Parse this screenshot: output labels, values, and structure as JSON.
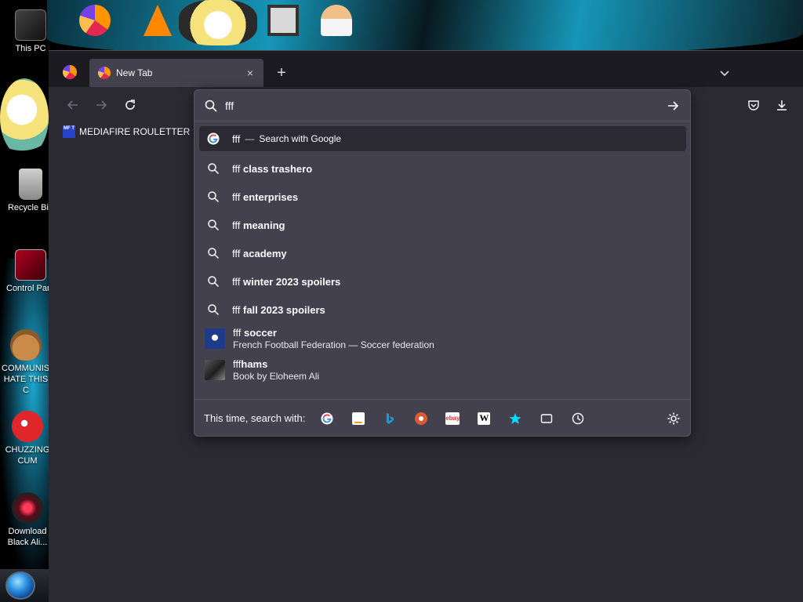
{
  "desktop": {
    "icons": [
      {
        "label": "This PC"
      },
      {
        "label": "Recycle Bin"
      },
      {
        "label": "Control Panel"
      },
      {
        "label": "COMMUNISM HATE THIS C"
      },
      {
        "label": "CHUZZING CUM"
      },
      {
        "label": "Download Black Ali..."
      }
    ]
  },
  "browser": {
    "tab": {
      "title": "New Tab",
      "close_glyph": "×"
    },
    "newtab_glyph": "+",
    "listall_glyph": "⌄",
    "bookmarks": [
      {
        "label": "MEDIAFIRE ROULETTER",
        "favicon_text": "MF T"
      }
    ],
    "urlbar": {
      "value": "fff",
      "results": [
        {
          "type": "search-engine",
          "prefix": "fff",
          "separator": "—",
          "action": "Search with Google",
          "selected": true
        },
        {
          "type": "suggestion",
          "prefix": "fff",
          "suffix": "class trashero"
        },
        {
          "type": "suggestion",
          "prefix": "fff",
          "suffix": "enterprises"
        },
        {
          "type": "suggestion",
          "prefix": "fff",
          "suffix": "meaning"
        },
        {
          "type": "suggestion",
          "prefix": "fff",
          "suffix": "academy"
        },
        {
          "type": "suggestion",
          "prefix": "fff",
          "suffix": "winter 2023 spoilers"
        },
        {
          "type": "suggestion",
          "prefix": "fff",
          "suffix": "fall 2023 spoilers"
        },
        {
          "type": "rich",
          "prefix": "fff",
          "suffix": "soccer",
          "subtitle": "French Football Federation — Soccer federation"
        },
        {
          "type": "rich",
          "prefix": "fff",
          "suffix": "hams",
          "subtitle": "Book by Eloheem Ali"
        }
      ],
      "oneoff": {
        "label": "This time, search with:",
        "engines": [
          {
            "name": "Google",
            "icon": "google-icon"
          },
          {
            "name": "Amazon",
            "icon": "amazon-icon"
          },
          {
            "name": "Bing",
            "icon": "bing-icon"
          },
          {
            "name": "DuckDuckGo",
            "icon": "duckduckgo-icon"
          },
          {
            "name": "eBay",
            "icon": "ebay-icon",
            "text": "ebay"
          },
          {
            "name": "Wikipedia",
            "icon": "wikipedia-icon",
            "text": "W"
          },
          {
            "name": "Bookmarks",
            "icon": "star-icon"
          },
          {
            "name": "Tabs",
            "icon": "tabs-icon"
          },
          {
            "name": "History",
            "icon": "history-icon"
          }
        ]
      }
    }
  },
  "colors": {
    "toolbar": "#2b2a33",
    "tab_active": "#42414d",
    "popup": "#42414d",
    "text": "#fbfbfe",
    "accent_blue": "#00ddff"
  }
}
